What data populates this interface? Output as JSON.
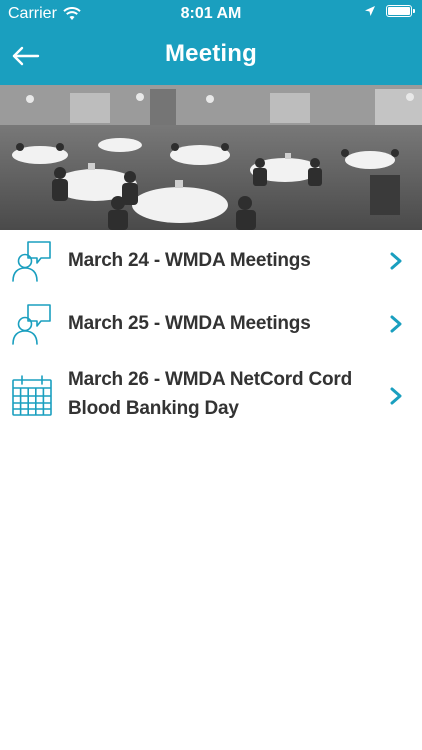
{
  "status_bar": {
    "carrier": "Carrier",
    "time": "8:01 AM"
  },
  "nav": {
    "title": "Meeting"
  },
  "colors": {
    "brand": "#1a9fbf",
    "text": "#333333",
    "icon": "#1a9fbf"
  },
  "items": [
    {
      "label": "March 24 - WMDA Meetings",
      "icon": "chat-people-icon"
    },
    {
      "label": "March 25 - WMDA Meetings",
      "icon": "chat-people-icon"
    },
    {
      "label": "March 26 - WMDA NetCord Cord Blood Banking Day",
      "icon": "calendar-icon"
    }
  ]
}
